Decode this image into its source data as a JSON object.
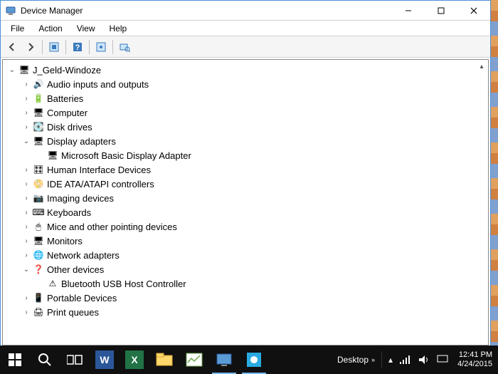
{
  "window": {
    "title": "Device Manager"
  },
  "menubar": [
    "File",
    "Action",
    "View",
    "Help"
  ],
  "tree": [
    {
      "depth": 0,
      "expanded": true,
      "icon": "computer-icon",
      "glyph": "🖥",
      "label": "J_Geld-Windoze"
    },
    {
      "depth": 1,
      "expanded": false,
      "icon": "audio-icon",
      "glyph": "🔊",
      "label": "Audio inputs and outputs"
    },
    {
      "depth": 1,
      "expanded": false,
      "icon": "battery-icon",
      "glyph": "🔋",
      "label": "Batteries"
    },
    {
      "depth": 1,
      "expanded": false,
      "icon": "computer-icon",
      "glyph": "🖥",
      "label": "Computer"
    },
    {
      "depth": 1,
      "expanded": false,
      "icon": "disk-icon",
      "glyph": "💽",
      "label": "Disk drives"
    },
    {
      "depth": 1,
      "expanded": true,
      "icon": "display-icon",
      "glyph": "🖥",
      "label": "Display adapters"
    },
    {
      "depth": 2,
      "leaf": true,
      "icon": "display-icon",
      "glyph": "🖥",
      "label": "Microsoft Basic Display Adapter"
    },
    {
      "depth": 1,
      "expanded": false,
      "icon": "hid-icon",
      "glyph": "🎛",
      "label": "Human Interface Devices"
    },
    {
      "depth": 1,
      "expanded": false,
      "icon": "ide-icon",
      "glyph": "📀",
      "label": "IDE ATA/ATAPI controllers"
    },
    {
      "depth": 1,
      "expanded": false,
      "icon": "imaging-icon",
      "glyph": "📷",
      "label": "Imaging devices"
    },
    {
      "depth": 1,
      "expanded": false,
      "icon": "keyboard-icon",
      "glyph": "⌨",
      "label": "Keyboards"
    },
    {
      "depth": 1,
      "expanded": false,
      "icon": "mouse-icon",
      "glyph": "🖱",
      "label": "Mice and other pointing devices"
    },
    {
      "depth": 1,
      "expanded": false,
      "icon": "monitor-icon",
      "glyph": "🖥",
      "label": "Monitors"
    },
    {
      "depth": 1,
      "expanded": false,
      "icon": "network-icon",
      "glyph": "🌐",
      "label": "Network adapters"
    },
    {
      "depth": 1,
      "expanded": true,
      "icon": "other-icon",
      "glyph": "❓",
      "label": "Other devices"
    },
    {
      "depth": 2,
      "leaf": true,
      "icon": "warning-icon",
      "glyph": "⚠",
      "label": "Bluetooth USB Host Controller"
    },
    {
      "depth": 1,
      "expanded": false,
      "icon": "portable-icon",
      "glyph": "📱",
      "label": "Portable Devices"
    },
    {
      "depth": 1,
      "expanded": false,
      "icon": "printer-icon",
      "glyph": "🖨",
      "label": "Print queues"
    }
  ],
  "tray": {
    "desktop": "Desktop",
    "time": "12:41 PM",
    "date": "4/24/2015"
  }
}
